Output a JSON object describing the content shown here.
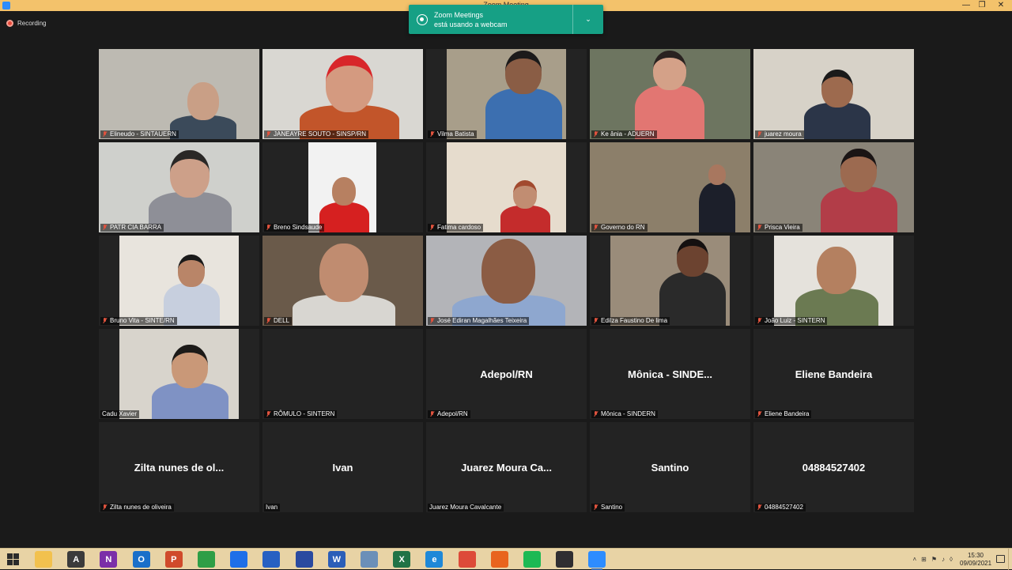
{
  "window": {
    "title": "Zoom Meeting",
    "minimize_glyph": "—",
    "restore_glyph": "❐",
    "close_glyph": "✕"
  },
  "recording": {
    "label": "Recording"
  },
  "toast": {
    "line1": "Zoom Meetings",
    "line2": "está usando a webcam",
    "chevron": "⌄"
  },
  "participants": [
    {
      "name": "Elineudo - SINTAUERN",
      "muted": true,
      "video": true
    },
    {
      "name": "JANEAYRE SOUTO - SINSP/RN",
      "muted": true,
      "video": true
    },
    {
      "name": "Vilma Batista",
      "muted": true,
      "video": true
    },
    {
      "name": "Ke ânia - ADUERN",
      "muted": true,
      "video": true
    },
    {
      "name": "juarez moura",
      "muted": true,
      "video": true
    },
    {
      "name": "PATR CIA BARRA",
      "muted": true,
      "video": true
    },
    {
      "name": "Breno Sindsaude",
      "muted": true,
      "video": true
    },
    {
      "name": "Fatima cardoso",
      "muted": true,
      "video": true
    },
    {
      "name": "Governo do RN",
      "muted": true,
      "video": true,
      "active": true
    },
    {
      "name": "Prisca Vieira",
      "muted": true,
      "video": true
    },
    {
      "name": "Bruno Vita - SINTE/RN",
      "muted": true,
      "video": true
    },
    {
      "name": "DELL",
      "muted": true,
      "video": true
    },
    {
      "name": "José Ediran Magalhães Teixeira",
      "muted": true,
      "video": true
    },
    {
      "name": "Edilza Faustino De lima",
      "muted": true,
      "video": true
    },
    {
      "name": "João Luiz - SINTERN",
      "muted": true,
      "video": true
    },
    {
      "name": "Cadu Xavier",
      "muted": false,
      "video": true
    },
    {
      "name": "RÔMULO - SINTERN",
      "muted": true,
      "video": false,
      "display": ""
    },
    {
      "name": "Adepol/RN",
      "muted": true,
      "video": false,
      "display": "Adepol/RN"
    },
    {
      "name": "Mônica - SINDERN",
      "muted": true,
      "video": false,
      "display": "Mônica - SINDE..."
    },
    {
      "name": "Eliene Bandeira",
      "muted": true,
      "video": false,
      "display": "Eliene Bandeira"
    },
    {
      "name": "Zilta nunes de oliveira",
      "muted": true,
      "video": false,
      "display": "Zilta nunes de ol..."
    },
    {
      "name": "Ivan",
      "muted": false,
      "video": false,
      "display": "Ivan"
    },
    {
      "name": "Juarez Moura Cavalcante",
      "muted": false,
      "video": false,
      "display": "Juarez Moura Ca..."
    },
    {
      "name": "Santino",
      "muted": true,
      "video": false,
      "display": "Santino"
    },
    {
      "name": "04884527402",
      "muted": true,
      "video": false,
      "display": "04884527402"
    }
  ],
  "taskbar": {
    "apps": [
      {
        "icon": "file-explorer-icon",
        "label": "",
        "color": "#f2c14e"
      },
      {
        "icon": "typora-icon",
        "label": "A",
        "color": "#3b3b3b"
      },
      {
        "icon": "onenote-icon",
        "label": "N",
        "color": "#7b2fa8"
      },
      {
        "icon": "outlook-icon",
        "label": "O",
        "color": "#1a6fc9"
      },
      {
        "icon": "powerpoint-icon",
        "label": "P",
        "color": "#d04a2b"
      },
      {
        "icon": "calculator-icon",
        "label": "",
        "color": "#2e9e46"
      },
      {
        "icon": "dropbox-icon",
        "label": "",
        "color": "#1e6fe8"
      },
      {
        "icon": "qr-app-icon",
        "label": "",
        "color": "#2760c2"
      },
      {
        "icon": "photos-icon",
        "label": "",
        "color": "#2a4aa0"
      },
      {
        "icon": "word-icon",
        "label": "W",
        "color": "#2b5eb8"
      },
      {
        "icon": "notepad-icon",
        "label": "",
        "color": "#6b8fb8"
      },
      {
        "icon": "excel-icon",
        "label": "X",
        "color": "#217346"
      },
      {
        "icon": "edge-icon",
        "label": "e",
        "color": "#1e88d8"
      },
      {
        "icon": "chrome-icon",
        "label": "",
        "color": "#dd4b39"
      },
      {
        "icon": "firefox-icon",
        "label": "",
        "color": "#e8641e"
      },
      {
        "icon": "spotify-icon",
        "label": "",
        "color": "#1db954"
      },
      {
        "icon": "obs-icon",
        "label": "",
        "color": "#302e31"
      },
      {
        "icon": "zoom-icon",
        "label": "",
        "color": "#2d8cff"
      }
    ],
    "tray_glyphs": [
      "˄",
      "⊞",
      "⚑",
      "♪",
      "◊"
    ],
    "time": "15:30",
    "date": "09/09/2021"
  }
}
